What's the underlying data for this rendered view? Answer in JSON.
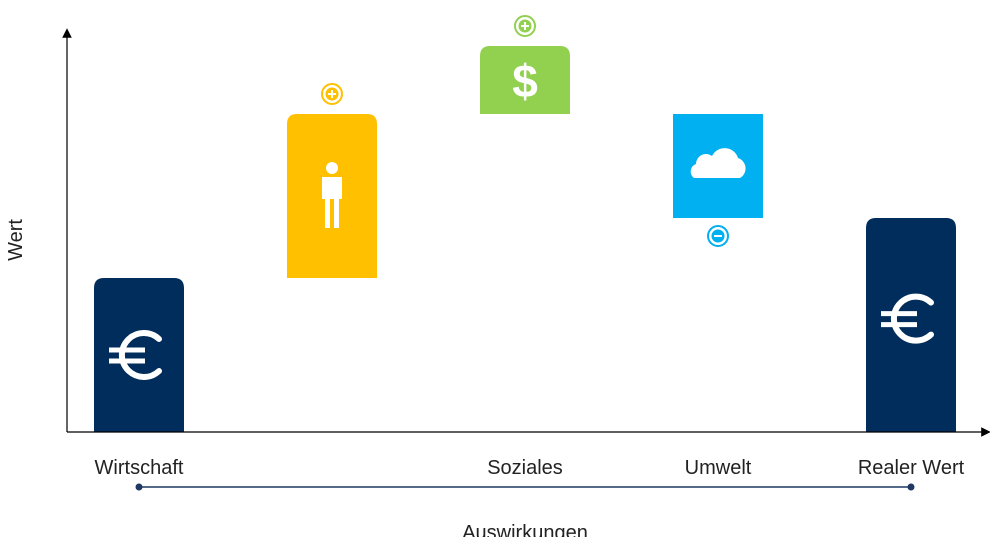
{
  "chart_data": {
    "type": "bar",
    "subtype": "waterfall",
    "ylabel": "Wert",
    "xlabel": "Auswirkungen",
    "ylim": [
      0,
      100
    ],
    "grid": false,
    "legend": "none",
    "categories": [
      "Wirtschaft",
      "Personal",
      "Soziales",
      "Umwelt",
      "Realer Wert"
    ],
    "category_labels_shown": [
      "Wirtschaft",
      "",
      "Soziales",
      "Umwelt",
      "Realer Wert"
    ],
    "bars": [
      {
        "category": "Wirtschaft",
        "kind": "total",
        "start": 0,
        "end": 38.5,
        "color": "#002d5b",
        "icon": "euro-icon",
        "sign_marker": ""
      },
      {
        "category": "Personal",
        "kind": "increase",
        "start": 38.5,
        "end": 79.5,
        "color": "#ffc000",
        "icon": "person-icon",
        "sign_marker": "plus"
      },
      {
        "category": "Soziales",
        "kind": "increase",
        "start": 79.5,
        "end": 96.5,
        "color": "#92d050",
        "icon": "dollar-icon",
        "sign_marker": "plus"
      },
      {
        "category": "Umwelt",
        "kind": "decrease",
        "start": 79.5,
        "end": 53.5,
        "color": "#00b0f0",
        "icon": "cloud-icon",
        "sign_marker": "minus"
      },
      {
        "category": "Realer Wert",
        "kind": "total",
        "start": 0,
        "end": 53.5,
        "color": "#002d5b",
        "icon": "euro-icon",
        "sign_marker": ""
      }
    ]
  },
  "colors": {
    "axis": "#000000",
    "timeline": "#1f3864",
    "text": "#222222"
  }
}
